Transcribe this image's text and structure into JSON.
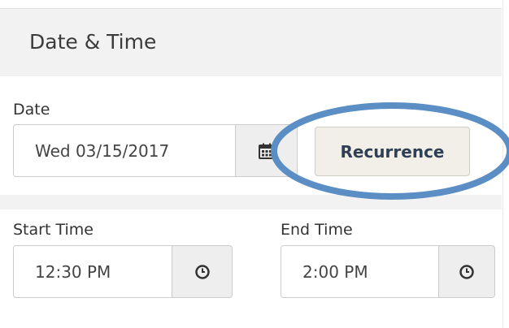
{
  "section": {
    "title": "Date & Time"
  },
  "date": {
    "label": "Date",
    "value": "Wed 03/15/2017"
  },
  "recurrence": {
    "label": "Recurrence"
  },
  "start_time": {
    "label": "Start Time",
    "value": "12:30 PM"
  },
  "end_time": {
    "label": "End Time",
    "value": "2:00 PM"
  },
  "colors": {
    "highlight": "#5b8ec4",
    "panel": "#f2f2f2"
  },
  "icons": {
    "date_picker": "calendar-icon",
    "time_picker": "clock-icon"
  }
}
